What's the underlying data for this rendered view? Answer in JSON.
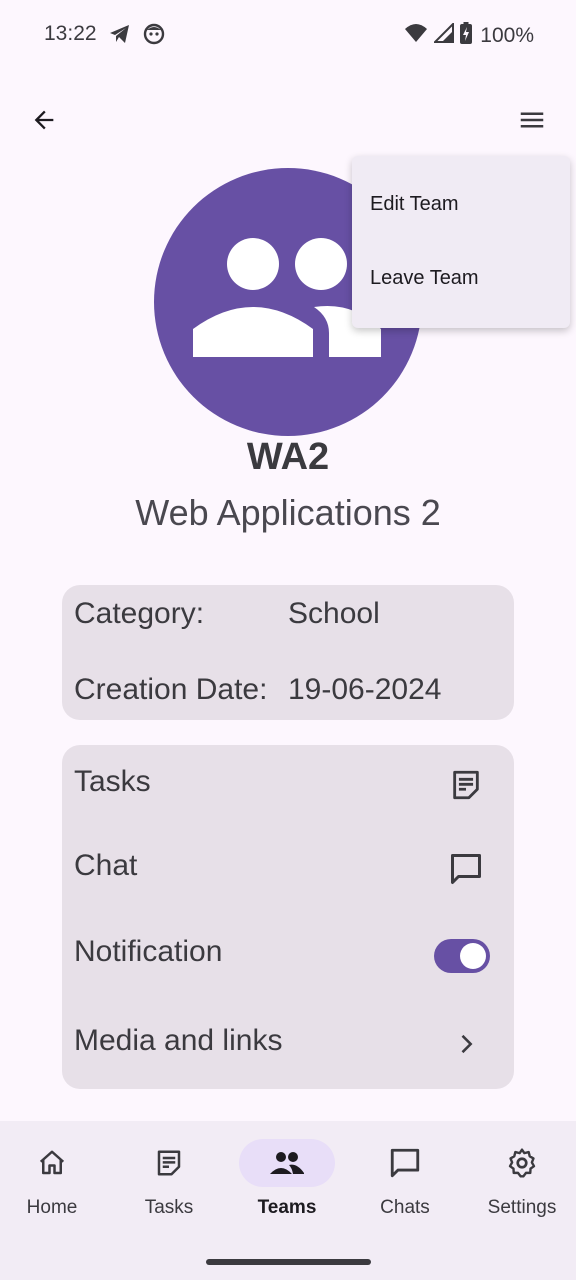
{
  "status_bar": {
    "time": "13:22",
    "battery": "100%"
  },
  "team": {
    "short_name": "WA2",
    "full_name": "Web Applications 2"
  },
  "info": {
    "category_label": "Category:",
    "category_value": "School",
    "date_label": "Creation Date:",
    "date_value": "19-06-2024"
  },
  "menu": {
    "tasks": "Tasks",
    "chat": "Chat",
    "notification": "Notification",
    "notification_enabled": true,
    "media": "Media and links"
  },
  "dropdown": {
    "edit": "Edit Team",
    "leave": "Leave Team"
  },
  "bottom_nav": {
    "items": [
      {
        "label": "Home",
        "icon": "home-icon",
        "active": false
      },
      {
        "label": "Tasks",
        "icon": "tasks-icon",
        "active": false
      },
      {
        "label": "Teams",
        "icon": "teams-icon",
        "active": true
      },
      {
        "label": "Chats",
        "icon": "chat-icon",
        "active": false
      },
      {
        "label": "Settings",
        "icon": "gear-icon",
        "active": false
      }
    ]
  },
  "colors": {
    "accent": "#6750a4",
    "card": "#e7e0e8",
    "background": "#fdf7fe"
  }
}
